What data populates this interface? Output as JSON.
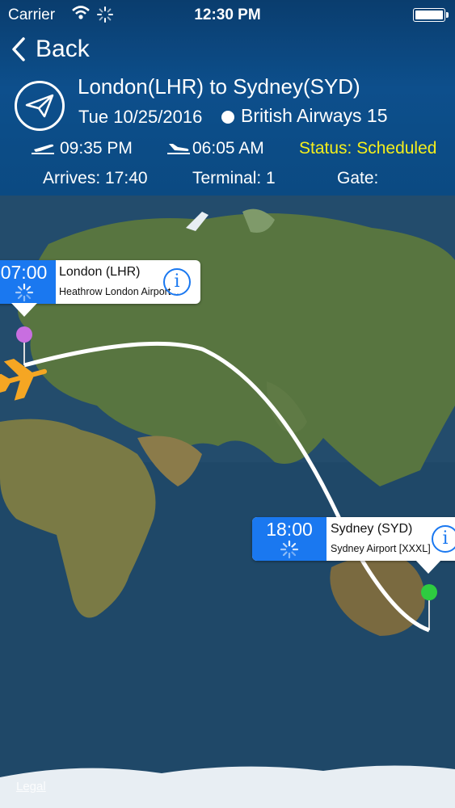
{
  "status_bar": {
    "carrier": "Carrier",
    "time": "12:30 PM"
  },
  "nav": {
    "back_label": "Back"
  },
  "flight": {
    "route": "London(LHR) to Sydney(SYD)",
    "date": "Tue 10/25/2016",
    "airline": "British Airways 15",
    "departure_time": "09:35 PM",
    "arrival_time": "06:05 AM",
    "status": "Status: Scheduled",
    "arrives": "Arrives: 17:40",
    "terminal": "Terminal: 1",
    "gate": "Gate:"
  },
  "map": {
    "origin": {
      "time": "07:00",
      "title": "London (LHR)",
      "subtitle": "Heathrow London Airport ..."
    },
    "destination": {
      "time": "18:00",
      "title": "Sydney (SYD)",
      "subtitle": "Sydney Airport [XXXL]"
    },
    "legal": "Legal"
  },
  "colors": {
    "status": "#f4ee1c",
    "accent": "#1a78f0",
    "origin_pin": "#c86ee0",
    "destination_pin": "#2ecc40",
    "plane": "#f5a623"
  }
}
